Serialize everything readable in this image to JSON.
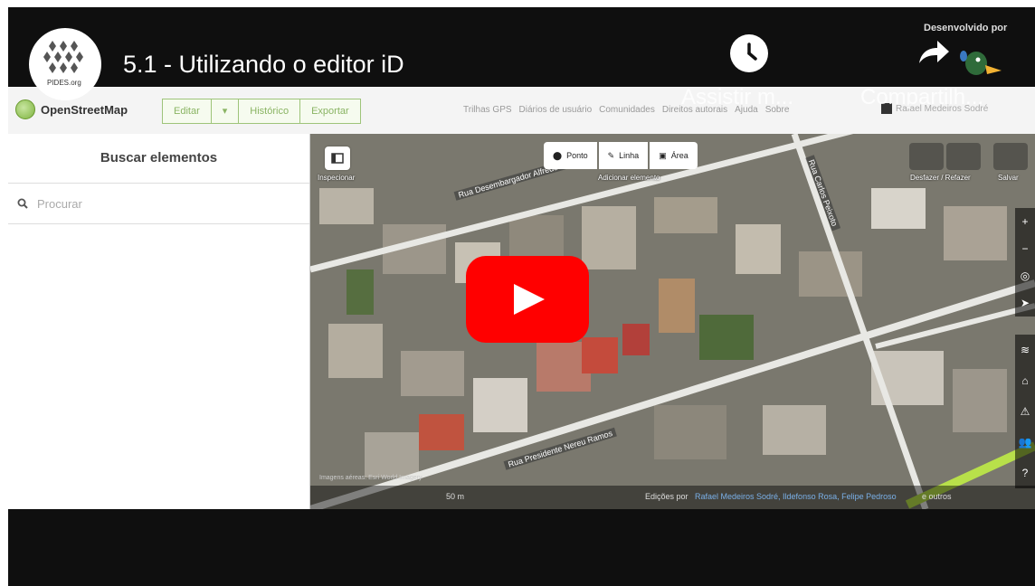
{
  "video": {
    "title": "5.1 - Utilizando o editor iD",
    "channel_avatar_text": "PIDES.org",
    "watch_later_label": "Assistir m...",
    "share_label": "Compartilh...",
    "developed_by_label": "Desenvolvido por",
    "colors": {
      "play_button": "#ff0000",
      "frame": "#0f0f0f"
    }
  },
  "osm": {
    "brand": "OpenStreetMap",
    "nav_buttons": [
      "Editar",
      "▾",
      "Histórico",
      "Exportar"
    ],
    "nav_links": [
      "Trilhas GPS",
      "Diários de usuário",
      "Comunidades",
      "Direitos autorais",
      "Ajuda",
      "Sobre"
    ],
    "user_name": "Rafael Medeiros Sodré",
    "sidebar_title": "Buscar elementos",
    "search_placeholder": "Procurar",
    "inspect_label": "Inspecionar",
    "add_feature_label": "Adicionar elemento",
    "add_buttons": [
      "Ponto",
      "Linha",
      "Área"
    ],
    "undo_label": "Desfazer / Refazer",
    "save_label": "Salvar",
    "streets": [
      "Rua Desembargador Alfredo Russel",
      "Rua Presidente Nereu Ramos",
      "Rua Carlos Peixoto"
    ],
    "scale_label": "50 m",
    "footer_edit_prefix": "Edições por",
    "footer_editors": "Rafael Medeiros Sodré, Ildefonso Rosa, Felipe Pedroso",
    "footer_others": "e outros",
    "footer_caption": "Imagens aéreas: Esri World Imagery",
    "map_controls": [
      "+",
      "−",
      "◎",
      "➤",
      "≋",
      "⌂",
      "⚠",
      "👥",
      "?"
    ]
  }
}
